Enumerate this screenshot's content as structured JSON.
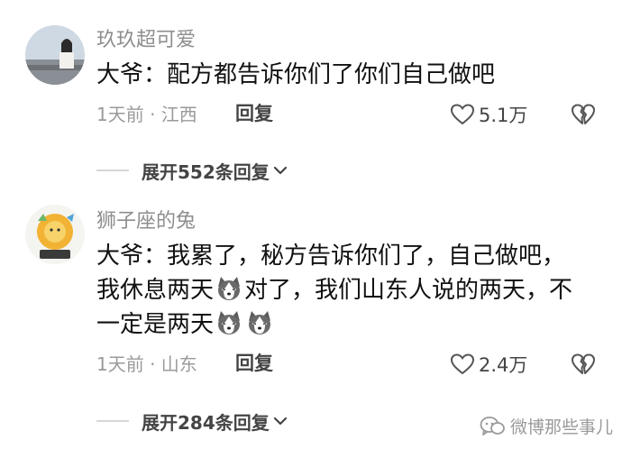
{
  "comments": [
    {
      "username": "玖玖超可爱",
      "text_lines": [
        "大爷：配方都告诉你们了你们自己做吧"
      ],
      "meta": "1天前 · 江西",
      "reply_label": "回复",
      "like_count": "5.1万",
      "expand_label": "展开552条回复"
    },
    {
      "username": "狮子座的兔",
      "text_parts": {
        "line1": "大爷：我累了，秘方告诉你们了，自己做吧，",
        "line2a": "我休息两天",
        "line2b": "对了，我们山东人说的两天，不",
        "line3": "一定是两天"
      },
      "meta": "1天前 · 山东",
      "reply_label": "回复",
      "like_count": "2.4万",
      "expand_label": "展开284条回复"
    }
  ],
  "watermark": "微博那些事儿",
  "icons": {
    "like": "heart-outline-icon",
    "dislike": "broken-heart-icon",
    "expand": "chevron-down-icon",
    "emoji": "husky-dog-emoji",
    "watermark": "wechat-icon"
  },
  "colors": {
    "text": "#111111",
    "muted": "#9a9a9a",
    "action": "#444444"
  }
}
